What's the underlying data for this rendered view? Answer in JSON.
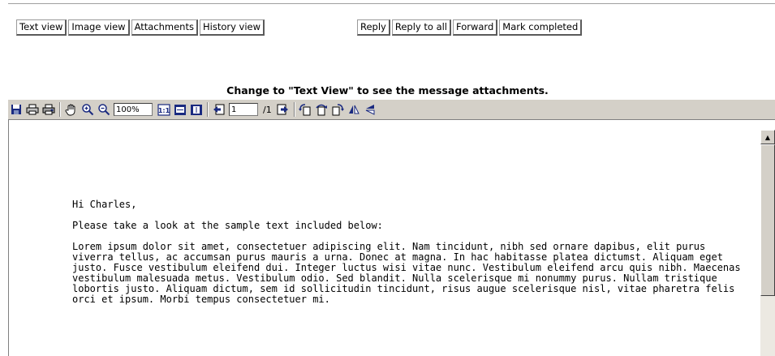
{
  "view_buttons": [
    {
      "label": "Text view"
    },
    {
      "label": "Image view"
    },
    {
      "label": "Attachments"
    },
    {
      "label": "History view"
    }
  ],
  "action_buttons": [
    {
      "label": "Reply"
    },
    {
      "label": "Reply to all"
    },
    {
      "label": "Forward"
    },
    {
      "label": "Mark completed"
    }
  ],
  "notice": "Change to \"Text View\" to see the message attachments.",
  "toolbar": {
    "icons": [
      "save-icon",
      "print-icon",
      "print-setup-icon",
      "pan-hand-icon",
      "zoom-in-icon",
      "zoom-out-icon",
      "actual-size-icon",
      "fit-width-icon",
      "fit-page-icon",
      "previous-page-icon",
      "next-page-icon",
      "rotate-left-icon",
      "rotate-180-icon",
      "rotate-right-icon",
      "flip-vertical-icon",
      "flip-horizontal-icon"
    ],
    "zoom": "100%",
    "page": "1",
    "page_total": "/1"
  },
  "document": {
    "greeting": "Hi Charles,",
    "intro": "Please take a look at the sample text included below:",
    "body": "Lorem ipsum dolor sit amet, consectetuer adipiscing elit. Nam tincidunt, nibh sed ornare dapibus, elit purus viverra tellus, ac accumsan purus mauris a urna. Donec at magna. In hac habitasse platea dictumst. Aliquam eget justo. Fusce vestibulum eleifend dui. Integer luctus wisi vitae nunc. Vestibulum eleifend arcu quis nibh. Maecenas vestibulum malesuada metus. Vestibulum odio. Sed blandit. Nulla scelerisque mi nonummy purus. Nullam tristique lobortis justo. Aliquam dictum, sem id sollicitudin tincidunt, risus augue scelerisque nisl, vitae pharetra felis orci et ipsum. Morbi tempus consectetuer mi."
  }
}
